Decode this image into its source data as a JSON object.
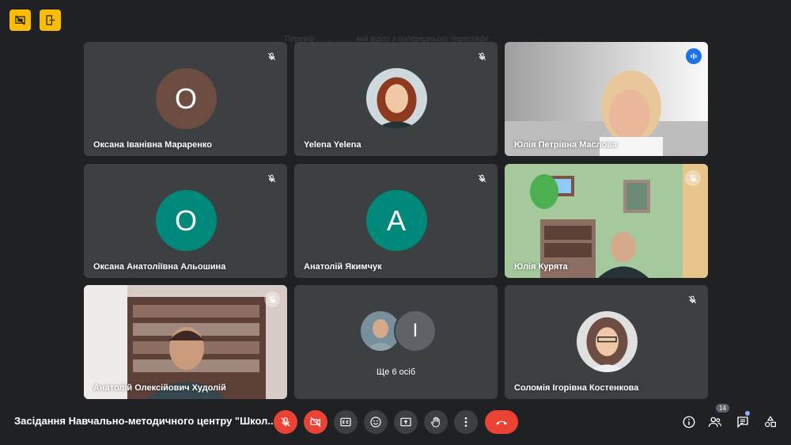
{
  "top_buttons": [
    {
      "icon": "no-present-icon"
    },
    {
      "icon": "exit-door-icon"
    }
  ],
  "watermark": "Перевір        … … … … мій відео з попереднього перегляду",
  "participants": [
    {
      "name": "Оксана Іванівна Мараренко",
      "initial": "О",
      "avatar_color": "#6d4c41",
      "muted": true
    },
    {
      "name": "Yelena Yelena",
      "muted": true
    },
    {
      "name": "Юлія Петрівна Маслова",
      "speaking": true
    },
    {
      "name": "Оксана Анатоліївна Альошина",
      "initial": "О",
      "avatar_color": "#00897b",
      "muted": true
    },
    {
      "name": "Анатолій Якимчук",
      "initial": "А",
      "avatar_color": "#00897b",
      "muted": true
    },
    {
      "name": "Юлія Курята",
      "muted": true
    },
    {
      "name": "Анатолій Олексійович Худолій",
      "muted": true
    },
    {
      "others_initial": "І",
      "others_label": "Ще 6 осіб"
    },
    {
      "name": "Соломія Ігорівна Костенкова",
      "muted": true
    }
  ],
  "meeting_title": "Засідання Навчально-методичного центру \"Школ...",
  "controls": {
    "mic": "mic-off-icon",
    "camera": "camera-off-icon",
    "captions": "captions-icon",
    "reactions": "emoji-icon",
    "present": "present-screen-icon",
    "raise_hand": "raise-hand-icon",
    "more": "more-options-icon",
    "end_call": "end-call-icon"
  },
  "right_controls": {
    "info": "info-icon",
    "people_count": "14",
    "chat": "chat-icon",
    "activities": "activities-icon"
  },
  "colors": {
    "background": "#202124",
    "tile": "#3c4043",
    "red": "#ea4335",
    "accent": "#8ab4f8",
    "warning": "#fbbc04"
  }
}
